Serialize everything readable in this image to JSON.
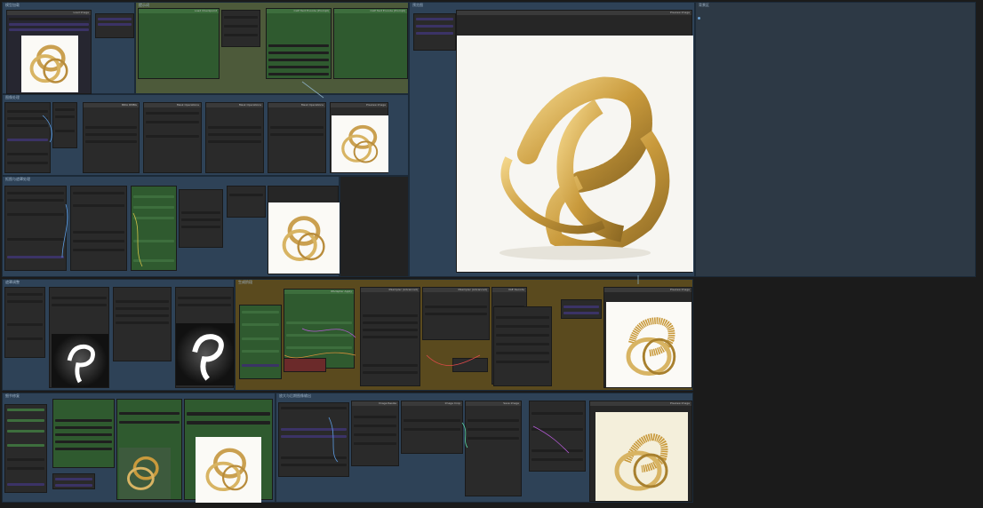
{
  "app": {
    "title": "ComfyUI workflow canvas"
  },
  "colors": {
    "canvas_bg": "#1b1b1b",
    "group_blue": "#2e4257",
    "group_green": "#4d5a3a",
    "group_brown": "#5a4a1e",
    "node_bg": "#2a2a2a",
    "node_green": "#2f5a2f",
    "node_purple": "#3b3366",
    "ring_gold": "#d4aa55"
  },
  "groups": {
    "g1": "模型加载",
    "g2": "图片输入",
    "g3": "提示词",
    "g4": "预览图",
    "g5": "图像处理",
    "g6": "抠图与遮罩处理",
    "g7": "遮罩调整",
    "g8": "生成阶段",
    "g9": "细节修复",
    "g10": "放大与后期图像输出",
    "g11": "背景区"
  },
  "nodes": {
    "loader": "Load Image",
    "ckpt": "Load Checkpoint",
    "clip_pos": "CLIP Text Encode (Prompt)",
    "clip_neg": "CLIP Text Encode (Prompt)",
    "preview_main": "Preview Image",
    "resize": "Image Resize",
    "crop": "Image Crop",
    "rmbg": "BRIA RMBG",
    "mask_ops": "Mask Operations",
    "preview_small": "Preview Image",
    "sampler1": "KSampler (Advanced)",
    "sampler2": "KSampler (Advanced)",
    "vae_decode": "VAE Decode",
    "preview_out": "Preview Image",
    "ipadapter": "IPAdapter Apply",
    "save": "Save Image"
  },
  "icons": {
    "ring_image": "gold-ring-image",
    "mask_image": "ring-mask-image",
    "link": "link-wire"
  }
}
